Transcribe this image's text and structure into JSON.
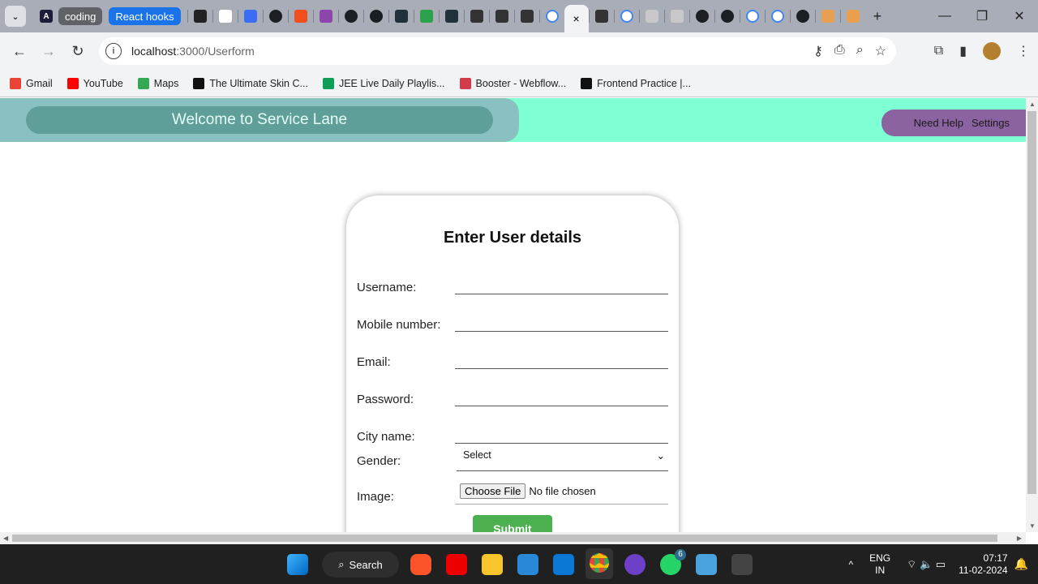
{
  "browser": {
    "tab_groups": [
      {
        "label": "coding",
        "color": "#5f6368"
      },
      {
        "label": "React hooks",
        "color": "#1a73e8"
      }
    ],
    "tab_icons": [
      "angular-icon",
      "fill-icon",
      "notion-icon",
      "docs-icon",
      "github-icon",
      "figma-icon",
      "info-icon",
      "github-icon",
      "github-icon",
      "react-icon",
      "w-icon",
      "react-icon",
      "s-icon",
      "openai-icon",
      "openai-icon",
      "google-icon"
    ],
    "tab_icons_after": [
      "download-icon",
      "google-icon",
      "globe-icon",
      "globe-icon",
      "github-icon",
      "github-icon",
      "google-icon",
      "google-icon",
      "github-icon",
      "pen-icon",
      "pen-icon"
    ],
    "active_tab_close": "×",
    "new_tab": "+",
    "url_host": "localhost",
    "url_path": ":3000/Userform",
    "bookmarks": [
      {
        "label": "Gmail",
        "icon": "gmail-icon",
        "color": "#ea4335"
      },
      {
        "label": "YouTube",
        "icon": "youtube-icon",
        "color": "#ff0000"
      },
      {
        "label": "Maps",
        "icon": "maps-icon",
        "color": "#34a853"
      },
      {
        "label": "The Ultimate Skin C...",
        "icon": "bookmark-icon",
        "color": "#111111"
      },
      {
        "label": "JEE Live Daily Playlis...",
        "icon": "bookmark-icon",
        "color": "#0f9d58"
      },
      {
        "label": "Booster - Webflow...",
        "icon": "webflow-icon",
        "color": "#d33a4a"
      },
      {
        "label": "Frontend Practice |...",
        "icon": "fp-icon",
        "color": "#111111"
      }
    ]
  },
  "app": {
    "welcome": "Welcome to Service Lane",
    "nav": [
      "Need Help",
      "Settings"
    ],
    "colors": {
      "header": "#7fffd4",
      "left": "#88c1bf",
      "pill": "#5f9e99",
      "nav": "#8a63a0",
      "submit": "#4caf50"
    }
  },
  "form": {
    "title": "Enter User details",
    "fields": [
      {
        "label": "Username:"
      },
      {
        "label": "Mobile number:"
      },
      {
        "label": "Email:"
      },
      {
        "label": "Password:"
      },
      {
        "label": "City name:"
      }
    ],
    "gender_label": "Gender:",
    "gender_value": "Select",
    "image_label": "Image:",
    "file_button": "Choose File",
    "file_status": "No file chosen",
    "submit": "Submit"
  },
  "taskbar": {
    "search": "Search",
    "lang1": "ENG",
    "lang2": "IN",
    "time": "07:17",
    "date": "11-02-2024",
    "whatsapp_badge": "6"
  }
}
